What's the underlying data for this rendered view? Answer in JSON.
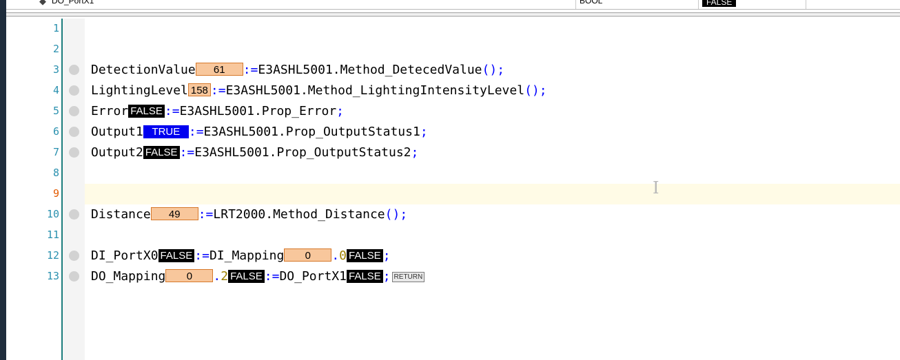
{
  "declaration_row": {
    "name": "DO_PortX1",
    "type": "BOOL",
    "value": "FALSE"
  },
  "lines": [
    {
      "num": "1",
      "breakpoint": false
    },
    {
      "num": "2",
      "breakpoint": false
    },
    {
      "num": "3",
      "breakpoint": true,
      "var": "DetectionValue",
      "monitor": "61",
      "assign": ":=",
      "expr": "E3ASHL5001.Method_DetecedValue",
      "parens": "()",
      "semi": ";"
    },
    {
      "num": "4",
      "breakpoint": true,
      "var": "LightingLevel",
      "monitor": "158",
      "assign": ":=",
      "expr": "E3ASHL5001.Method_LightingIntensityLevel",
      "parens": "()",
      "semi": ";"
    },
    {
      "num": "5",
      "breakpoint": true,
      "var": "Error",
      "monitor": "FALSE",
      "assign": ":=",
      "expr": "E3ASHL5001.Prop_Error",
      "semi": ";"
    },
    {
      "num": "6",
      "breakpoint": true,
      "var": "Output1",
      "monitor": "TRUE",
      "assign": ":=",
      "expr": "E3ASHL5001.Prop_OutputStatus1",
      "semi": ";"
    },
    {
      "num": "7",
      "breakpoint": true,
      "var": "Output2",
      "monitor": "FALSE",
      "assign": ":=",
      "expr": "E3ASHL5001.Prop_OutputStatus2",
      "semi": ";"
    },
    {
      "num": "8",
      "breakpoint": false
    },
    {
      "num": "9",
      "breakpoint": false,
      "current": true
    },
    {
      "num": "10",
      "breakpoint": true,
      "var": "Distance",
      "monitor": "49",
      "assign": ":=",
      "expr": "LRT2000.Method_Distance",
      "parens": "()",
      "semi": ";"
    },
    {
      "num": "11",
      "breakpoint": false
    },
    {
      "num": "12",
      "breakpoint": true,
      "var": "DI_PortX0",
      "monitor": "FALSE",
      "assign": ":=",
      "expr": "DI_Mapping",
      "expr_monitor": "0",
      "dot": ".",
      "bit": "0",
      "bit_monitor": "FALSE",
      "semi": ";"
    },
    {
      "num": "13",
      "breakpoint": true,
      "var": "DO_Mapping",
      "monitor": "0",
      "dot": ".",
      "bit": "2",
      "bit_monitor": "FALSE",
      "assign": ":=",
      "expr": "DO_PortX1",
      "expr_monitor": "FALSE",
      "semi": ";",
      "return_label": "RETURN"
    }
  ],
  "colors": {
    "keyword_blue": "#0000ff",
    "line_number": "#2b91af",
    "current_line_number": "#e35a00",
    "numeric_monitor_bg": "#f8c79c",
    "bool_false_bg": "#000000",
    "bool_true_bg": "#0000f0",
    "current_line_bg": "#fffbe6"
  }
}
